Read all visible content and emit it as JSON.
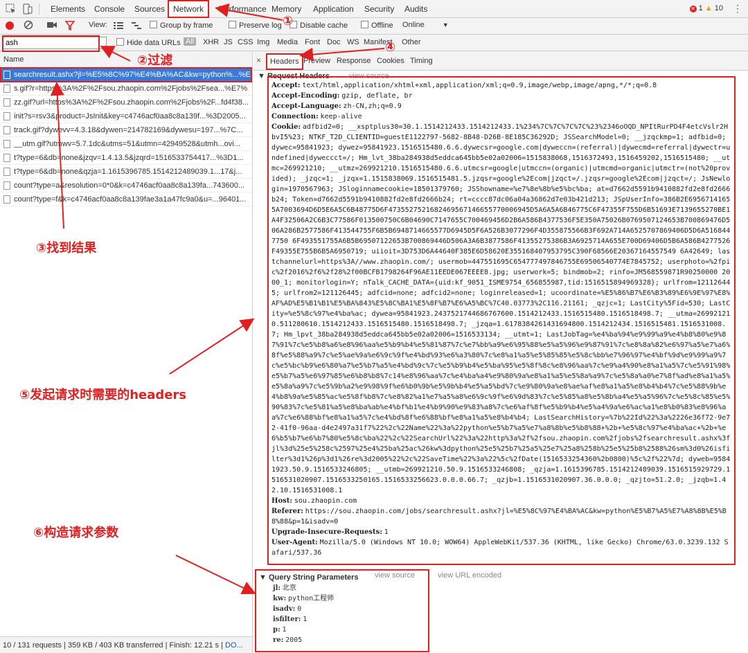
{
  "topbar": {
    "tabs": [
      "Elements",
      "Console",
      "Sources",
      "Network",
      "Performance",
      "Memory",
      "Application",
      "Security",
      "Audits"
    ],
    "errors": "1",
    "warnings": "10",
    "kebab": "⋮"
  },
  "nettool": {
    "view_label": "View:",
    "group_by_frame": "Group by frame",
    "preserve_log": "Preserve log",
    "disable_cache": "Disable cache",
    "offline": "Offline",
    "throttle": "Online"
  },
  "filter": {
    "value": "ash",
    "hide_data_urls": "Hide data URLs",
    "types": [
      "All",
      "XHR",
      "JS",
      "CSS",
      "Img",
      "Media",
      "Font",
      "Doc",
      "WS",
      "Manifest",
      "Other"
    ]
  },
  "left": {
    "name_header": "Name",
    "requests": [
      "searchresult.ashx?jl=%E5%8C%97%E4%BA%AC&kw=python%...%E",
      "s.gif?r=https%3A%2F%2Fsou.zhaopin.com%2Fjobs%2Fsea...%E7%",
      "zz.gif?url=https%3A%2F%2Fsou.zhaopin.com%2Fjobs%2F...fd4f38...",
      "init?s=rsv3&product=JsInit&key=c4746acf0aa8c8a139f...%3D2005...",
      "track.gif?dywevv=4.3.18&dywen=214782169&dywesu=197...%7C...",
      "__utm.gif?utmwv=5.7.1dc&utms=51&utmn=42949528&utmh...ovi...",
      "t?type=6&db=none&jzqv=1.4.13.5&jzqrd=1516533754417...%3D1...",
      "t?type=6&db=none&qzja=1.1615396785.1514212489039.1...17&j...",
      "count?type=a&resolution=0*0&k=c4746acf0aa8c8a139fa...743600...",
      "count?type=f&k=c4746acf0aa8c8a139fae3a1a47fc9a0&u=...96401..."
    ],
    "status": "10 / 131 requests  |  359 KB / 403 KB transferred  |  Finish: 12.21 s  |",
    "status_link": "DO..."
  },
  "right": {
    "close": "×",
    "tabs": [
      "Headers",
      "Preview",
      "Response",
      "Cookies",
      "Timing"
    ],
    "req_headers_title": "▼ Request Headers",
    "view_source": "view source",
    "headers": [
      {
        "k": "Accept:",
        "v": "text/html,application/xhtml+xml,application/xml;q=0.9,image/webp,image/apng,*/*;q=0.8"
      },
      {
        "k": "Accept-Encoding:",
        "v": "gzip, deflate, br"
      },
      {
        "k": "Accept-Language:",
        "v": "zh-CN,zh;q=0.9"
      },
      {
        "k": "Connection:",
        "v": "keep-alive"
      },
      {
        "k": "Cookie:",
        "v": "adfbid2=0; __xsptplus30=30.1.1514212433.1514212433.1%234%7C%7C%7C%7C%23%2346oOQD_NPItRurPD4F4etcVslr2HbvI5%23; NTKF_T2D_CLIENTID=guestE1122797-5682-8B48-D26B-8E185C36292D; JSSearchModel=0; __jzqckmp=1; adfbid=0; dywec=95841923; dywez=95841923.1516515480.6.6.dywecsr=google.com|dyweccn=(referral)|dywecmd=referral|dywectr=undefined|dyweccct=/; Hm_lvt_38ba284938d5eddca645bb5e02a02006=1515838068,1516372493,1516459202,1516515480; __utmc=269921210; __utmz=269921210.1516515480.6.6.utmcsr=google|utmccn=(organic)|utmcmd=organic|utmctr=(not%20provided); _jzqc=1; _jzqx=1.1515838069.1516515481.5.jzqsr=google%2Ecom|jzqct=/.jzqsr=google%2Ecom|jzqct=/; JsNewlogin=1970567963; JSloginnamecookie=18501379760; JSShowname=%e7%8e%8b%e5%bc%ba; at=d7662d5591b9410882fd2e8fd2666b24; Token=d7662d5591b9410882fd2e8fd2666b24; rt=cccc87dc06a04a36862d7e03b421d213; JSpUserInfo=386B2E69567141655A7003694D6D5E6A5C6B48775D6F4735527521682469567146655770006945D5A6A5A6B46775C6F47355F755D6B51693E7139655270BE1A4F32506A2C6B3C77586F013500750C6B04690C7147655C700469456D2B6A586B4377536F5E350A75026B0769507124653B700869476D506A286B2577586F413544755F6B5B6948714665577D6945D5F6A526B3077296F4D355875566B3F692A714A6525707869406D5D6A5168447750 6F493551755A6B5B69507122653B700869446D506A3A6B3877586F41355275386B3A6925714A655E700D69406D5B6A586B4277526F49355E755B6B5A6950719; uiioit=3D753D6A44640F385E6D58620E355168407953795C390F68566E20367164557549 6A42649; lastchannelurl=https%3A//www.zhaopin.com/; usermob=447551695C654777497846755E69506540774E7845752; userphoto=%2fpic%2f2016%2f6%2f28%2f00BCFB1798264F96AE11EEDE067EEEE8.jpg; userwork=5; bindmob=2; rinfo=JM568559871R90250000 2000_1; monitorlogin=Y; nTalk_CACHE_DATA={uid:kf_9051_ISME9754_656855987,tid:1516515894969328}; urlfrom=121126445; urlfrom2=121126445; adfcid=none; adfcid2=none; loginreleased=1; ucoordinate=%E5%86%B7%E6%B3%89%E6%9E%97%E8%AF%AD%E5%B1%B1%E5%BA%843%E5%8C%BA1%E5%8F%B7%E6%A5%BC%7C40.03773%2C116.21161; _qzjc=1; LastCity%5Fid=530; LastCity=%e5%8c%97%e4%ba%ac; dywea=95841923.2437521744686767600.1514212433.1516515480.1516518498.7; __utma=269921210.511280610.1514212433.1516515480.1516518498.7; _jzqa=1.6178384261431694800.1514212434.1516515481.1516531008.7; Hm_lpvt_38ba284938d5eddca645bb5e02a02006=1516533134; __utmt=1; LastJobTag=%e4%ba%94%e9%99%a9%e4%b8%80%e9%87%91%7c%e5%b8%a6%e8%96%aa%e5%b9%b4%e5%81%87%7c%e7%bb%a9%e6%95%88%e5%a5%96%e9%87%91%7c%e8%8a%82%e6%97%a5%e7%a6%8f%e5%88%a9%7c%e5%ae%9a%e6%9c%9f%e4%bd%93%e6%a3%80%7c%e8%a1%a5%e5%85%85%e5%8c%bb%e7%96%97%e4%bf%9d%e9%99%a9%7c%e5%bc%b9%e6%80%a7%e5%b7%a5%e4%bd%9c%7c%e5%b9%b4%e5%ba%95%e5%8f%8c%e8%96%aa%7c%e9%a4%90%e8%a1%a5%7c%e5%91%98%e5%b7%a5%e6%97%85%e6%b8%b8%7c14%e8%96%aa%7c%e4%ba%a4%e9%80%9a%e8%a1%a5%e5%8a%a9%7c%e5%8a%a0%e7%8f%ad%e8%a1%a5%e5%8a%a9%7c%e5%9b%a2%e9%98%9f%e6%b0%9b%e5%9b%b4%e5%a5%bd%7c%e9%80%9a%e8%ae%af%e8%a1%a5%e8%b4%b4%7c%e5%88%9b%e4%b8%9a%e5%85%ac%e5%8f%b8%7c%e8%82%a1%e7%a5%a8%e6%9c%9f%e6%9d%83%7c%e5%85%a8%e5%8b%a4%e5%a5%96%7c%e5%8c%85%e5%90%83%7c%e5%81%a5%e8%ba%ab%e4%bf%b1%e4%b9%90%e9%83%a8%7c%e6%af%8f%e5%b9%b4%e5%a4%9a%e6%ac%a1%e8%b0%83%e8%96%aa%7c%e6%88%bf%e8%a1%a5%7c%e4%bd%8f%e6%88%bf%e8%a1%a5%e8%b4%b4; LastSearchHistory=%7b%22Id%22%3a%2226e36f72-9e72-41f0-96aa-d4e2497a31f7%22%2c%22Name%22%3a%22python%e5%b7%a5%e7%a8%8b%e5%b8%88+%2b+%e5%8c%97%e4%ba%ac+%2b+%e6%b5%b7%e6%b7%80%e5%8c%ba%22%2c%22SearchUrl%22%3a%22http%3a%2f%2fsou.zhaopin.com%2fjobs%2fsearchresult.ashx%3fjl%3d%25e5%258c%2597%25e4%25ba%25ac%26kw%3dpython%25e5%25b7%25a5%25e7%25a8%258b%25e5%25b8%2588%26sm%3d0%26isfilter%3d1%26p%3d1%26re%3d2005%22%2c%22SaveTime%22%3a%22%5c%2fDate(1516533254360%2b0800)%5c%2f%22%7d; dyweb=95841923.50.9.1516533246805; __utmb=269921210.50.9.1516533246808; _qzja=1.1615396785.1514212489039.1516515929729.1516531020907.1516533250165.1516533256623.0.0.0.66.7; _qzjb=1.1516531020907.36.0.0.0; _qzjto=51.2.0; _jzqb=1.42.10.1516531008.1"
      },
      {
        "k": "Host:",
        "v": "sou.zhaopin.com"
      },
      {
        "k": "Referer:",
        "v": "https://sou.zhaopin.com/jobs/searchresult.ashx?jl=%E5%8C%97%E4%BA%AC&kw=python%E5%B7%A5%E7%A8%8B%E5%B8%88&p=1&isadv=0"
      },
      {
        "k": "Upgrade-Insecure-Requests:",
        "v": "1"
      },
      {
        "k": "User-Agent:",
        "v": "Mozilla/5.0 (Windows NT 10.0; WOW64) AppleWebKit/537.36 (KHTML, like Gecko) Chrome/63.0.3239.132 Safari/537.36"
      }
    ],
    "qs_title": "▼ Query String Parameters",
    "qs_view_source": "view source",
    "qs_view_url": "view URL encoded",
    "qs_params": [
      {
        "k": "jl:",
        "v": "北京"
      },
      {
        "k": "kw:",
        "v": "python工程师"
      },
      {
        "k": "isadv:",
        "v": "0"
      },
      {
        "k": "isfilter:",
        "v": "1"
      },
      {
        "k": "p:",
        "v": "1"
      },
      {
        "k": "re:",
        "v": "2005"
      }
    ]
  },
  "annotations": {
    "a1": "①",
    "a2": "②过滤",
    "a3": "③找到结果",
    "a4": "④",
    "a5": "⑤发起请求时需要的headers",
    "a6": "⑥构造请求参数"
  },
  "colors": {
    "annotation": "#e02020",
    "selected_row": "#3879d9"
  }
}
